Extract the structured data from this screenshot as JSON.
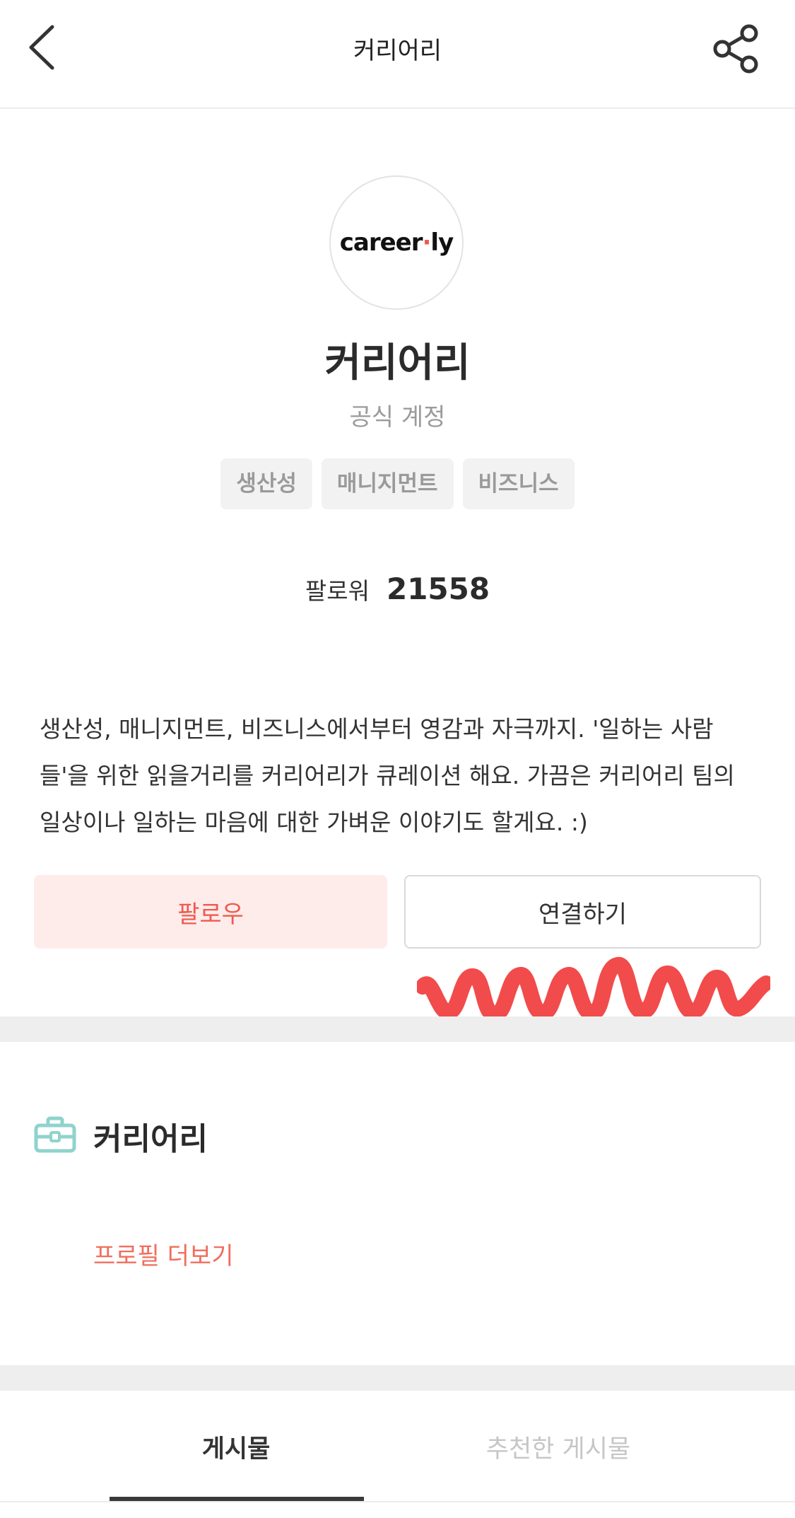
{
  "header": {
    "title": "커리어리",
    "back_icon": "chevron-left-icon",
    "share_icon": "share-icon"
  },
  "profile": {
    "logo": {
      "text_main": "career",
      "text_dot": "·",
      "text_end": "ly"
    },
    "name": "커리어리",
    "subtitle": "공식 계정",
    "tags": [
      "생산성",
      "매니지먼트",
      "비즈니스"
    ],
    "followers_label": "팔로워",
    "followers_count": "21558",
    "bio": "생산성, 매니지먼트, 비즈니스에서부터 영감과 자극까지. '일하는 사람들'을 위한 읽을거리를 커리어리가 큐레이션 해요. 가끔은 커리어리 팀의 일상이나 일하는 마음에 대한 가벼운 이야기도 할게요. :)"
  },
  "actions": {
    "follow_label": "팔로우",
    "connect_label": "연결하기"
  },
  "section": {
    "icon": "briefcase-icon",
    "title": "커리어리",
    "more_link": "프로필 더보기"
  },
  "tabs": {
    "items": [
      {
        "label": "게시물",
        "active": true
      },
      {
        "label": "추천한 게시물",
        "active": false
      }
    ]
  },
  "colors": {
    "accent": "#ef5b4f",
    "follow_bg": "#feeceb",
    "icon_teal": "#8fd3cc",
    "scribble": "#f24b4b"
  }
}
